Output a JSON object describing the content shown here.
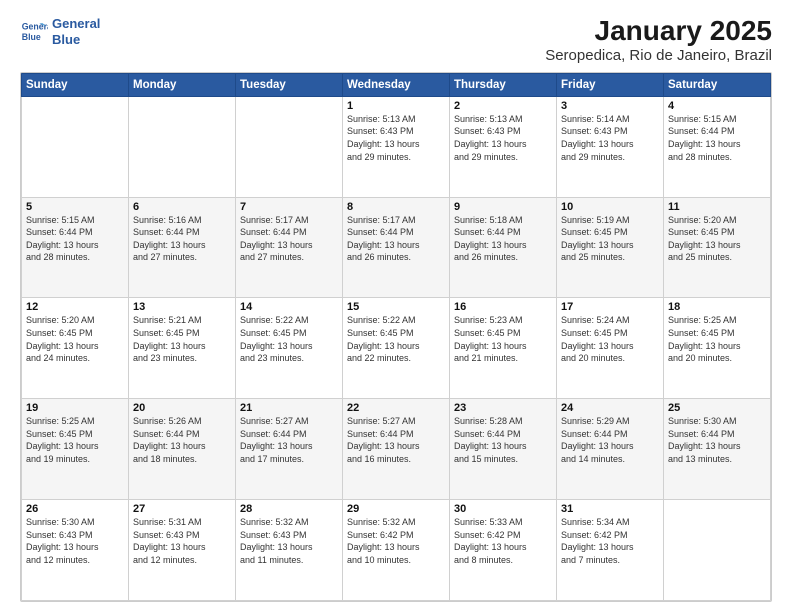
{
  "header": {
    "logo_line1": "General",
    "logo_line2": "Blue",
    "title": "January 2025",
    "subtitle": "Seropedica, Rio de Janeiro, Brazil"
  },
  "calendar": {
    "days_of_week": [
      "Sunday",
      "Monday",
      "Tuesday",
      "Wednesday",
      "Thursday",
      "Friday",
      "Saturday"
    ],
    "weeks": [
      [
        {
          "num": "",
          "info": ""
        },
        {
          "num": "",
          "info": ""
        },
        {
          "num": "",
          "info": ""
        },
        {
          "num": "1",
          "info": "Sunrise: 5:13 AM\nSunset: 6:43 PM\nDaylight: 13 hours\nand 29 minutes."
        },
        {
          "num": "2",
          "info": "Sunrise: 5:13 AM\nSunset: 6:43 PM\nDaylight: 13 hours\nand 29 minutes."
        },
        {
          "num": "3",
          "info": "Sunrise: 5:14 AM\nSunset: 6:43 PM\nDaylight: 13 hours\nand 29 minutes."
        },
        {
          "num": "4",
          "info": "Sunrise: 5:15 AM\nSunset: 6:44 PM\nDaylight: 13 hours\nand 28 minutes."
        }
      ],
      [
        {
          "num": "5",
          "info": "Sunrise: 5:15 AM\nSunset: 6:44 PM\nDaylight: 13 hours\nand 28 minutes."
        },
        {
          "num": "6",
          "info": "Sunrise: 5:16 AM\nSunset: 6:44 PM\nDaylight: 13 hours\nand 27 minutes."
        },
        {
          "num": "7",
          "info": "Sunrise: 5:17 AM\nSunset: 6:44 PM\nDaylight: 13 hours\nand 27 minutes."
        },
        {
          "num": "8",
          "info": "Sunrise: 5:17 AM\nSunset: 6:44 PM\nDaylight: 13 hours\nand 26 minutes."
        },
        {
          "num": "9",
          "info": "Sunrise: 5:18 AM\nSunset: 6:44 PM\nDaylight: 13 hours\nand 26 minutes."
        },
        {
          "num": "10",
          "info": "Sunrise: 5:19 AM\nSunset: 6:45 PM\nDaylight: 13 hours\nand 25 minutes."
        },
        {
          "num": "11",
          "info": "Sunrise: 5:20 AM\nSunset: 6:45 PM\nDaylight: 13 hours\nand 25 minutes."
        }
      ],
      [
        {
          "num": "12",
          "info": "Sunrise: 5:20 AM\nSunset: 6:45 PM\nDaylight: 13 hours\nand 24 minutes."
        },
        {
          "num": "13",
          "info": "Sunrise: 5:21 AM\nSunset: 6:45 PM\nDaylight: 13 hours\nand 23 minutes."
        },
        {
          "num": "14",
          "info": "Sunrise: 5:22 AM\nSunset: 6:45 PM\nDaylight: 13 hours\nand 23 minutes."
        },
        {
          "num": "15",
          "info": "Sunrise: 5:22 AM\nSunset: 6:45 PM\nDaylight: 13 hours\nand 22 minutes."
        },
        {
          "num": "16",
          "info": "Sunrise: 5:23 AM\nSunset: 6:45 PM\nDaylight: 13 hours\nand 21 minutes."
        },
        {
          "num": "17",
          "info": "Sunrise: 5:24 AM\nSunset: 6:45 PM\nDaylight: 13 hours\nand 20 minutes."
        },
        {
          "num": "18",
          "info": "Sunrise: 5:25 AM\nSunset: 6:45 PM\nDaylight: 13 hours\nand 20 minutes."
        }
      ],
      [
        {
          "num": "19",
          "info": "Sunrise: 5:25 AM\nSunset: 6:45 PM\nDaylight: 13 hours\nand 19 minutes."
        },
        {
          "num": "20",
          "info": "Sunrise: 5:26 AM\nSunset: 6:44 PM\nDaylight: 13 hours\nand 18 minutes."
        },
        {
          "num": "21",
          "info": "Sunrise: 5:27 AM\nSunset: 6:44 PM\nDaylight: 13 hours\nand 17 minutes."
        },
        {
          "num": "22",
          "info": "Sunrise: 5:27 AM\nSunset: 6:44 PM\nDaylight: 13 hours\nand 16 minutes."
        },
        {
          "num": "23",
          "info": "Sunrise: 5:28 AM\nSunset: 6:44 PM\nDaylight: 13 hours\nand 15 minutes."
        },
        {
          "num": "24",
          "info": "Sunrise: 5:29 AM\nSunset: 6:44 PM\nDaylight: 13 hours\nand 14 minutes."
        },
        {
          "num": "25",
          "info": "Sunrise: 5:30 AM\nSunset: 6:44 PM\nDaylight: 13 hours\nand 13 minutes."
        }
      ],
      [
        {
          "num": "26",
          "info": "Sunrise: 5:30 AM\nSunset: 6:43 PM\nDaylight: 13 hours\nand 12 minutes."
        },
        {
          "num": "27",
          "info": "Sunrise: 5:31 AM\nSunset: 6:43 PM\nDaylight: 13 hours\nand 12 minutes."
        },
        {
          "num": "28",
          "info": "Sunrise: 5:32 AM\nSunset: 6:43 PM\nDaylight: 13 hours\nand 11 minutes."
        },
        {
          "num": "29",
          "info": "Sunrise: 5:32 AM\nSunset: 6:42 PM\nDaylight: 13 hours\nand 10 minutes."
        },
        {
          "num": "30",
          "info": "Sunrise: 5:33 AM\nSunset: 6:42 PM\nDaylight: 13 hours\nand 8 minutes."
        },
        {
          "num": "31",
          "info": "Sunrise: 5:34 AM\nSunset: 6:42 PM\nDaylight: 13 hours\nand 7 minutes."
        },
        {
          "num": "",
          "info": ""
        }
      ]
    ]
  }
}
